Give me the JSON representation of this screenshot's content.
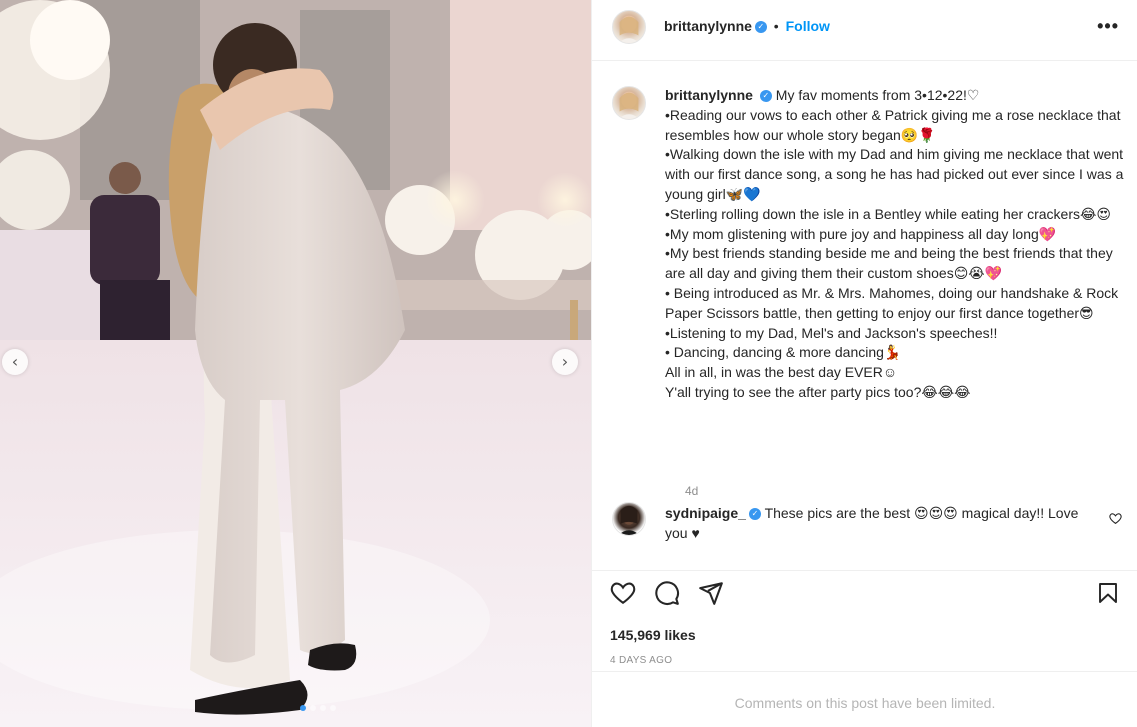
{
  "post": {
    "username": "brittanylynne",
    "follow_label": "Follow",
    "more_label": "•••",
    "caption": "My fav moments from 3•12•22!♡\n•Reading our vows to each other & Patrick giving me a rose necklace that resembles how our whole story began🥺🌹\n•Walking down the isle with my Dad and him giving me necklace that went with our first dance song, a song he has had picked out ever since I was a young girl🦋💙\n•Sterling rolling down the isle in a Bentley while eating her crackers😂😍\n•My mom glistening with pure joy and happiness all day long💖\n•My best friends standing beside me and being the best friends that they are all day and giving them their custom shoes😊😭💖\n• Being introduced as Mr. & Mrs. Mahomes, doing our handshake & Rock Paper Scissors battle, then getting to enjoy our first dance together😎\n•Listening to my Dad, Mel's and Jackson's speeches!!\n• Dancing, dancing & more dancing💃\nAll in all, in was the best day EVER☺\nY'all trying to see the after party pics too?😂😂😂",
    "caption_age": "4d",
    "likes": "145,969 likes",
    "time_ago": "4 DAYS AGO",
    "comments_limited": "Comments on this post have been limited."
  },
  "comment": {
    "username": "sydnipaige_",
    "text": "These pics are the best 😍😍😍 magical day!! Love you ♥"
  },
  "carousel": {
    "prev": "‹",
    "next": "›",
    "slide_count": 4,
    "active_slide": 1
  },
  "colors": {
    "accent": "#0095f6",
    "verified": "#3897f0",
    "muted": "#8e8e8e",
    "border": "#efefef"
  },
  "icons": [
    "verified-badge-icon",
    "more-options-icon",
    "heart-icon",
    "comment-icon",
    "share-icon",
    "bookmark-icon",
    "chevron-left-icon",
    "chevron-right-icon"
  ]
}
